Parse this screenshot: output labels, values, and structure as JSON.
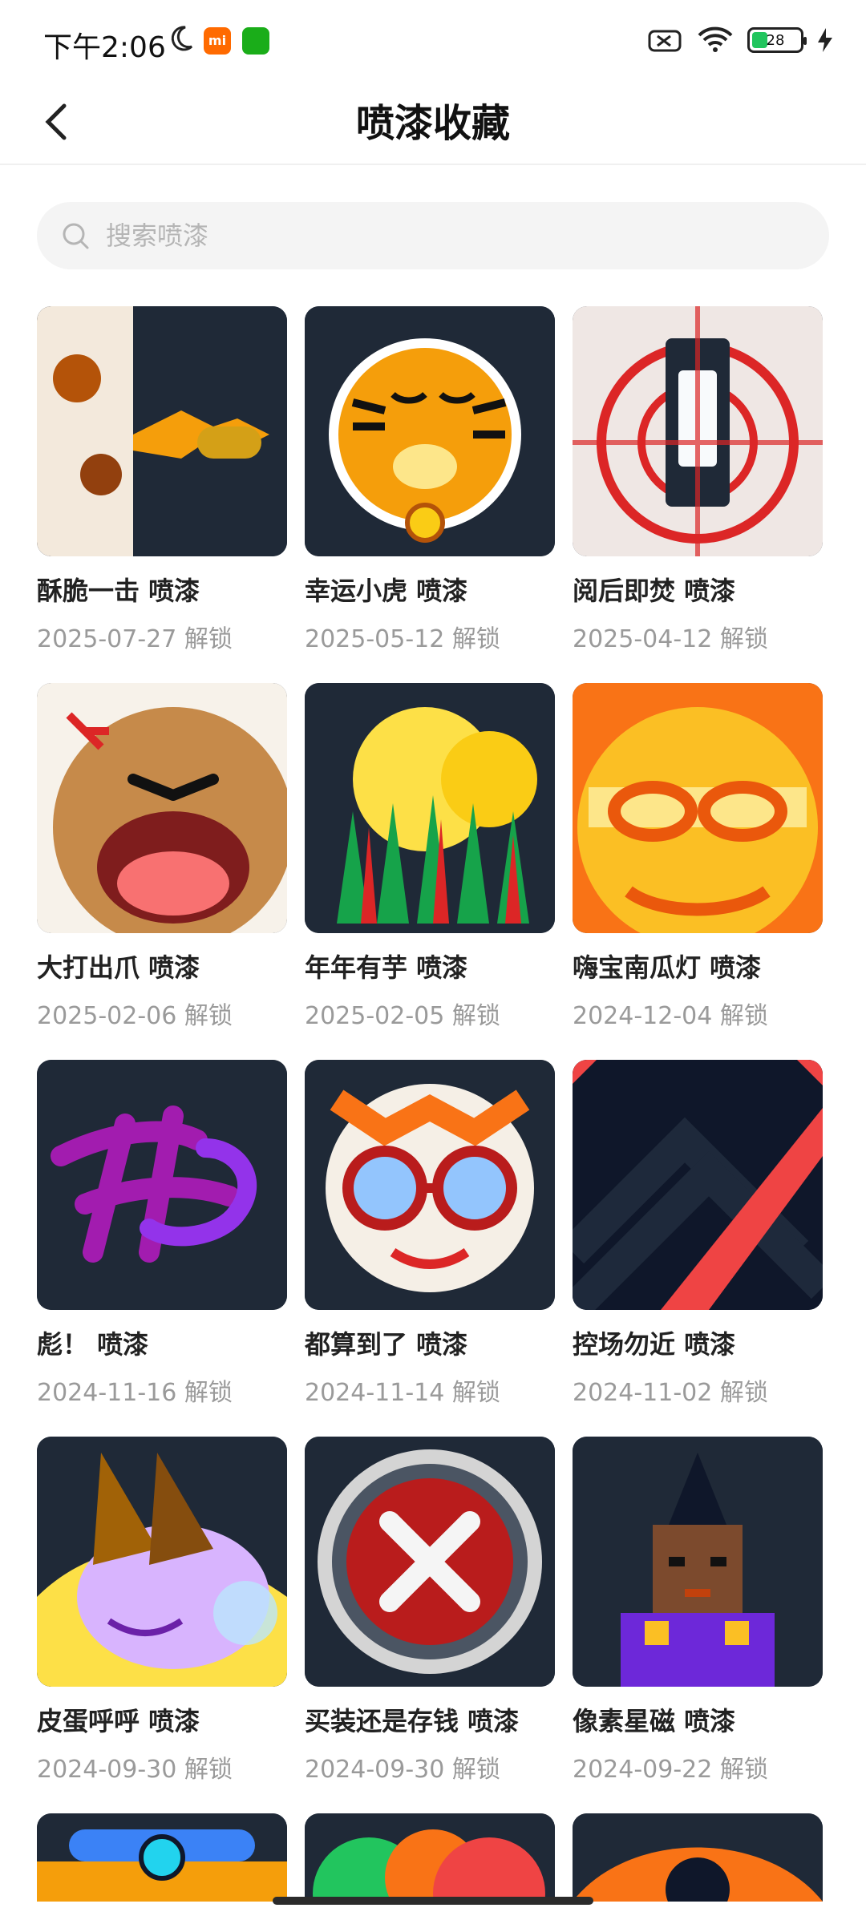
{
  "status_bar": {
    "time": "下午2:06",
    "battery": "28"
  },
  "header": {
    "title": "喷漆收藏"
  },
  "search": {
    "placeholder": "搜索喷漆"
  },
  "items": [
    {
      "name": "酥脆一击 喷漆",
      "date": "2025-07-27 解锁"
    },
    {
      "name": "幸运小虎 喷漆",
      "date": "2025-05-12 解锁"
    },
    {
      "name": "阅后即焚 喷漆",
      "date": "2025-04-12 解锁"
    },
    {
      "name": "大打出爪 喷漆",
      "date": "2025-02-06 解锁"
    },
    {
      "name": "年年有芋 喷漆",
      "date": "2025-02-05 解锁"
    },
    {
      "name": "嗨宝南瓜灯 喷漆",
      "date": "2024-12-04 解锁"
    },
    {
      "name": "彪！ 喷漆",
      "date": "2024-11-16 解锁"
    },
    {
      "name": "都算到了 喷漆",
      "date": "2024-11-14 解锁"
    },
    {
      "name": "控场勿近 喷漆",
      "date": "2024-11-02 解锁"
    },
    {
      "name": "皮蛋呼呼 喷漆",
      "date": "2024-09-30 解锁"
    },
    {
      "name": "买装还是存钱 喷漆",
      "date": "2024-09-30 解锁"
    },
    {
      "name": "像素星磁 喷漆",
      "date": "2024-09-22 解锁"
    }
  ]
}
